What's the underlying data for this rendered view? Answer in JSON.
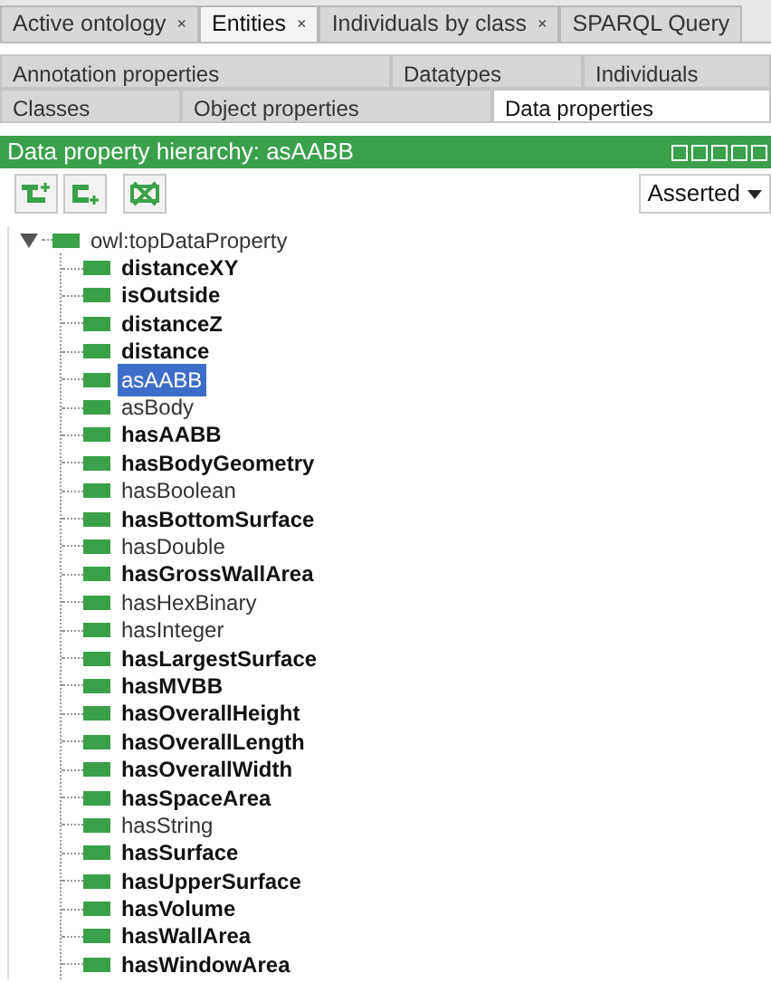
{
  "tabs": [
    {
      "label": "Active ontology",
      "close": "×",
      "selected": false
    },
    {
      "label": "Entities",
      "close": "×",
      "selected": true
    },
    {
      "label": "Individuals by class",
      "close": "×",
      "selected": false
    },
    {
      "label": "SPARQL Query",
      "selected": false
    }
  ],
  "entity_tabs": [
    [
      {
        "label": "Annotation properties",
        "selected": false
      },
      {
        "label": "Datatypes",
        "selected": false
      },
      {
        "label": "Individuals",
        "selected": false
      }
    ],
    [
      {
        "label": "Classes",
        "selected": false
      },
      {
        "label": "Object properties",
        "selected": false
      },
      {
        "label": "Data properties",
        "selected": true
      }
    ]
  ],
  "panel": {
    "title": "Data property hierarchy: asAABB",
    "view": "Asserted"
  },
  "tree": [
    {
      "label": "owl:topDataProperty",
      "bold": false,
      "selected": false,
      "expanded": true,
      "children": [
        {
          "label": "distanceXY",
          "bold": true,
          "selected": false
        },
        {
          "label": "isOutside",
          "bold": true,
          "selected": false
        },
        {
          "label": "distanceZ",
          "bold": true,
          "selected": false
        },
        {
          "label": "distance",
          "bold": true,
          "selected": false
        },
        {
          "label": "asAABB",
          "bold": false,
          "selected": true
        },
        {
          "label": "asBody",
          "bold": false,
          "selected": false
        },
        {
          "label": "hasAABB",
          "bold": true,
          "selected": false
        },
        {
          "label": "hasBodyGeometry",
          "bold": true,
          "selected": false
        },
        {
          "label": "hasBoolean",
          "bold": false,
          "selected": false
        },
        {
          "label": "hasBottomSurface",
          "bold": true,
          "selected": false
        },
        {
          "label": "hasDouble",
          "bold": false,
          "selected": false
        },
        {
          "label": "hasGrossWallArea",
          "bold": true,
          "selected": false
        },
        {
          "label": "hasHexBinary",
          "bold": false,
          "selected": false
        },
        {
          "label": "hasInteger",
          "bold": false,
          "selected": false
        },
        {
          "label": "hasLargestSurface",
          "bold": true,
          "selected": false
        },
        {
          "label": "hasMVBB",
          "bold": true,
          "selected": false
        },
        {
          "label": "hasOverallHeight",
          "bold": true,
          "selected": false
        },
        {
          "label": "hasOverallLength",
          "bold": true,
          "selected": false
        },
        {
          "label": "hasOverallWidth",
          "bold": true,
          "selected": false
        },
        {
          "label": "hasSpaceArea",
          "bold": true,
          "selected": false
        },
        {
          "label": "hasString",
          "bold": false,
          "selected": false
        },
        {
          "label": "hasSurface",
          "bold": true,
          "selected": false
        },
        {
          "label": "hasUpperSurface",
          "bold": true,
          "selected": false
        },
        {
          "label": "hasVolume",
          "bold": true,
          "selected": false
        },
        {
          "label": "hasWallArea",
          "bold": true,
          "selected": false
        },
        {
          "label": "hasWindowArea",
          "bold": true,
          "selected": false
        }
      ]
    }
  ]
}
